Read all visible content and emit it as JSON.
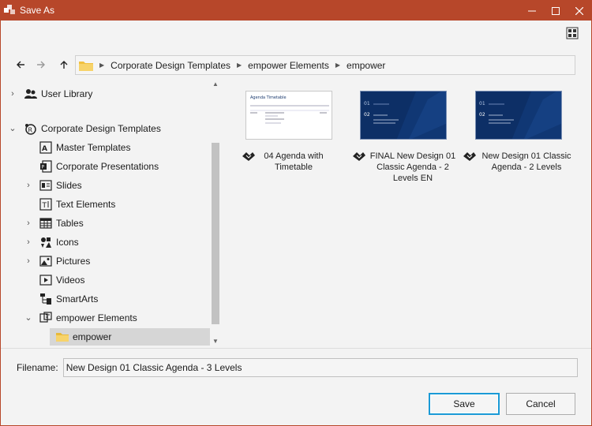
{
  "window": {
    "title": "Save As",
    "accent": "#b7472a"
  },
  "nav": {
    "back_icon": "back-arrow-icon",
    "forward_icon": "forward-arrow-icon",
    "up_icon": "up-arrow-icon",
    "breadcrumb": [
      "Corporate Design Templates",
      "empower Elements",
      "empower"
    ]
  },
  "tree": {
    "items": [
      {
        "label": "User Library",
        "icon": "user-library-icon"
      },
      {
        "label": "Corporate Design Templates",
        "icon": "corporate-design-icon"
      },
      {
        "label": "Master Templates",
        "icon": "master-templates-icon"
      },
      {
        "label": "Corporate Presentations",
        "icon": "presentations-icon"
      },
      {
        "label": "Slides",
        "icon": "slides-icon"
      },
      {
        "label": "Text Elements",
        "icon": "text-elements-icon"
      },
      {
        "label": "Tables",
        "icon": "tables-icon"
      },
      {
        "label": "Icons",
        "icon": "icons-icon"
      },
      {
        "label": "Pictures",
        "icon": "pictures-icon"
      },
      {
        "label": "Videos",
        "icon": "videos-icon"
      },
      {
        "label": "SmartArts",
        "icon": "smartarts-icon"
      },
      {
        "label": "empower Elements",
        "icon": "empower-elements-icon"
      },
      {
        "label": "empower",
        "icon": "folder-icon"
      }
    ]
  },
  "files": [
    {
      "name": "04 Agenda with Timetable",
      "thumb_title": "Agenda Timetable"
    },
    {
      "name": "FINAL New Design 01 Classic Agenda - 2 Levels EN",
      "thumb_items": [
        "01",
        "02"
      ]
    },
    {
      "name": "New Design 01 Classic Agenda - 2 Levels",
      "thumb_items": [
        "01",
        "02"
      ]
    }
  ],
  "filename": {
    "label": "Filename:",
    "value": "New Design 01 Classic Agenda - 3 Levels"
  },
  "buttons": {
    "save": "Save",
    "cancel": "Cancel"
  }
}
